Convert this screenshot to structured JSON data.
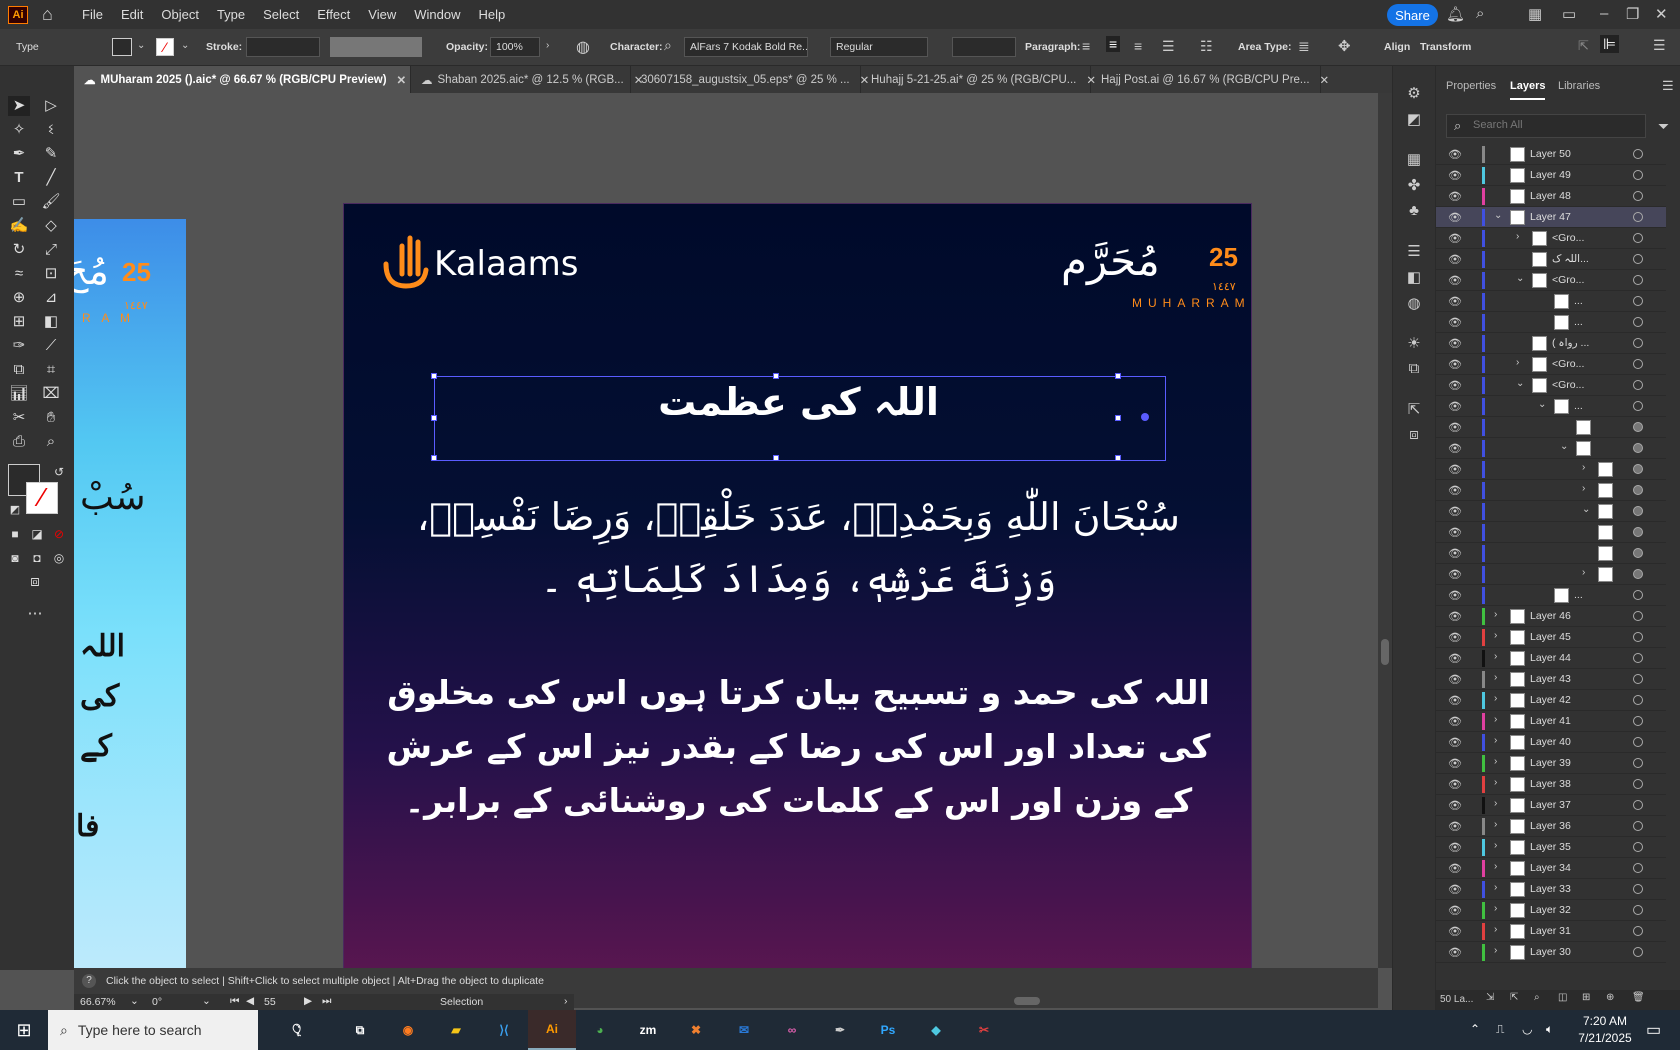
{
  "app": {
    "logo": "Ai",
    "menu": [
      "File",
      "Edit",
      "Object",
      "Type",
      "Select",
      "Effect",
      "View",
      "Window",
      "Help"
    ],
    "share_label": "Share"
  },
  "control_bar": {
    "tool_label": "Type",
    "stroke_label": "Stroke:",
    "opacity_label": "Opacity:",
    "opacity_value": "100%",
    "character_label": "Character:",
    "font_value": "AlFars 7 Kodak Bold Re...",
    "style_value": "Regular",
    "paragraph_label": "Paragraph:",
    "area_type_label": "Area Type:",
    "align_label": "Align",
    "transform_label": "Transform"
  },
  "tabs": [
    {
      "label": "MUharam 2025 ().aic* @ 66.67 % (RGB/CPU Preview)",
      "active": true
    },
    {
      "label": "Shaban 2025.aic* @ 12.5 % (RGB...",
      "active": false
    },
    {
      "label": "30607158_augustsix_05.eps* @ 25 % ...",
      "active": false
    },
    {
      "label": "Huhajj 5-21-25.ai* @ 25 % (RGB/CPU...",
      "active": false
    },
    {
      "label": "Hajj Post.ai @ 16.67 % (RGB/CPU Pre...",
      "active": false
    }
  ],
  "artboard": {
    "logo_text": "Kalaams",
    "muharram_number": "25",
    "muharram_arabic": "مُحَرَّم",
    "muharram_hijri": "١٤٤٧",
    "muharram_latin": "MUHARRAM",
    "heading": "اللہ کی عظمت",
    "arabic_lines": [
      "سُبْحَانَ اللّٰهِ وَبِحَمْدِهٖ، عَدَدَ خَلْقِهٖ، وَرِضَا نَفْسِهٖ،",
      "وَزِنَةَ عَرْشِهٖ، وَمِدَادَ كَلِمَاتِهٖ ۔"
    ],
    "urdu_lines": [
      "اللہ کی حمد و تسبیح بیان کرتا ہوں اس کی مخلوق",
      "کی تعداد اور اس کی رضا کے بقدر نیز اس کے عرش",
      "کے وزن اور اس کے کلمات کی روشنائی کے برابر۔"
    ]
  },
  "side_artboard": {
    "number": "25",
    "hijri": "١٤٤٧",
    "latin": "R A M",
    "text1": "سُبْ",
    "text2": "اللہ",
    "text3": "کی",
    "text4": "کے",
    "text5": "فا"
  },
  "status": {
    "hint": "Click the object to select  |  Shift+Click to select multiple object  |  Alt+Drag the object to duplicate",
    "zoom": "66.67%",
    "rotation": "0°",
    "artboard_num": "55",
    "tool": "Selection"
  },
  "panel": {
    "tabs": [
      "Properties",
      "Layers",
      "Libraries"
    ],
    "active_tab": "Layers",
    "search_placeholder": "Search All",
    "layers_count": "50 La...",
    "rows": [
      {
        "name": "Layer 50",
        "color": "#888888",
        "indent": 0,
        "chev": ""
      },
      {
        "name": "Layer 49",
        "color": "#4ec8e0",
        "indent": 0,
        "chev": ""
      },
      {
        "name": "Layer 48",
        "color": "#e040a0",
        "indent": 0,
        "chev": ""
      },
      {
        "name": "Layer 47",
        "color": "#4050e0",
        "indent": 0,
        "chev": "v",
        "sel": true
      },
      {
        "name": "<Gro...",
        "color": "#4050e0",
        "indent": 1,
        "chev": ">"
      },
      {
        "name": "اللہ ک...",
        "color": "#4050e0",
        "indent": 1,
        "chev": ""
      },
      {
        "name": "<Gro...",
        "color": "#4050e0",
        "indent": 1,
        "chev": "v"
      },
      {
        "name": "...",
        "color": "#4050e0",
        "indent": 2,
        "chev": ""
      },
      {
        "name": "...",
        "color": "#4050e0",
        "indent": 2,
        "chev": ""
      },
      {
        "name": "( رواہ ...",
        "color": "#4050e0",
        "indent": 1,
        "chev": ""
      },
      {
        "name": "<Gro...",
        "color": "#4050e0",
        "indent": 1,
        "chev": ">"
      },
      {
        "name": "<Gro...",
        "color": "#4050e0",
        "indent": 1,
        "chev": "v"
      },
      {
        "name": "...",
        "color": "#4050e0",
        "indent": 2,
        "chev": "v"
      },
      {
        "name": "",
        "color": "#4050e0",
        "indent": 3,
        "chev": ""
      },
      {
        "name": "",
        "color": "#4050e0",
        "indent": 3,
        "chev": "v"
      },
      {
        "name": "",
        "color": "#4050e0",
        "indent": 4,
        "chev": ">"
      },
      {
        "name": "",
        "color": "#4050e0",
        "indent": 4,
        "chev": ">"
      },
      {
        "name": "",
        "color": "#4050e0",
        "indent": 4,
        "chev": "v"
      },
      {
        "name": "",
        "color": "#4050e0",
        "indent": 4,
        "chev": ""
      },
      {
        "name": "",
        "color": "#4050e0",
        "indent": 4,
        "chev": ""
      },
      {
        "name": "",
        "color": "#4050e0",
        "indent": 4,
        "chev": ">"
      },
      {
        "name": "...",
        "color": "#4050e0",
        "indent": 2,
        "chev": ""
      },
      {
        "name": "Layer 46",
        "color": "#40c040",
        "indent": 0,
        "chev": ">"
      },
      {
        "name": "Layer 45",
        "color": "#e04040",
        "indent": 0,
        "chev": ">"
      },
      {
        "name": "Layer 44",
        "color": "#111111",
        "indent": 0,
        "chev": ">"
      },
      {
        "name": "Layer 43",
        "color": "#888888",
        "indent": 0,
        "chev": ">"
      },
      {
        "name": "Layer 42",
        "color": "#4ec8e0",
        "indent": 0,
        "chev": ">"
      },
      {
        "name": "Layer 41",
        "color": "#e040a0",
        "indent": 0,
        "chev": ">"
      },
      {
        "name": "Layer 40",
        "color": "#4050e0",
        "indent": 0,
        "chev": ">"
      },
      {
        "name": "Layer 39",
        "color": "#40c040",
        "indent": 0,
        "chev": ">"
      },
      {
        "name": "Layer 38",
        "color": "#e04040",
        "indent": 0,
        "chev": ">"
      },
      {
        "name": "Layer 37",
        "color": "#111111",
        "indent": 0,
        "chev": ">"
      },
      {
        "name": "Layer 36",
        "color": "#888888",
        "indent": 0,
        "chev": ">"
      },
      {
        "name": "Layer 35",
        "color": "#4ec8e0",
        "indent": 0,
        "chev": ">"
      },
      {
        "name": "Layer 34",
        "color": "#e040a0",
        "indent": 0,
        "chev": ">"
      },
      {
        "name": "Layer 33",
        "color": "#4050e0",
        "indent": 0,
        "chev": ">"
      },
      {
        "name": "Layer 32",
        "color": "#40c040",
        "indent": 0,
        "chev": ">"
      },
      {
        "name": "Layer 31",
        "color": "#e04040",
        "indent": 0,
        "chev": ">"
      },
      {
        "name": "Layer 30",
        "color": "#40c040",
        "indent": 0,
        "chev": ">"
      }
    ]
  },
  "taskbar": {
    "search_placeholder": "Type here to search",
    "time": "7:20 AM",
    "date": "7/21/2025",
    "apps": [
      "Ai",
      "Ps",
      "zm"
    ]
  },
  "colors": {
    "accent_orange": "#ff8c1a",
    "selection_blue": "#5a5cff",
    "share_blue": "#1473e6"
  }
}
